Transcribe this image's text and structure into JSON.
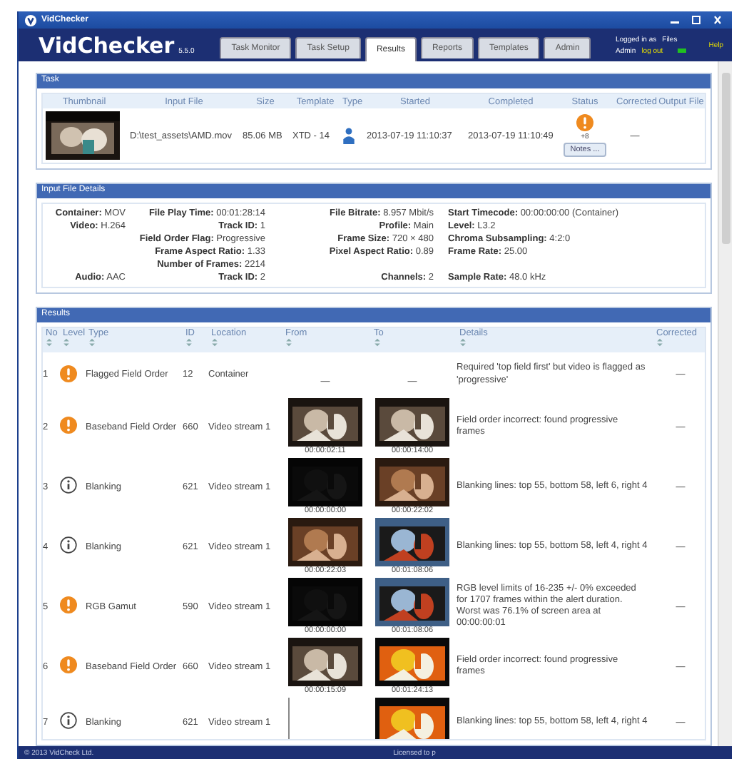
{
  "window": {
    "title": "VidChecker"
  },
  "header": {
    "logo": "VidChecker",
    "version": "5.5.0",
    "logged_in_label": "Logged in as",
    "user": "Admin",
    "logout": "log out",
    "files_label": "Files",
    "help": "Help"
  },
  "tabs": [
    {
      "label": "Task Monitor",
      "selected": false
    },
    {
      "label": "Task Setup",
      "selected": false
    },
    {
      "label": "Results",
      "selected": true
    },
    {
      "label": "Reports",
      "selected": false
    },
    {
      "label": "Templates",
      "selected": false
    },
    {
      "label": "Admin",
      "selected": false
    }
  ],
  "task": {
    "title": "Task",
    "columns": [
      "Thumbnail",
      "Input File",
      "Size",
      "Template",
      "Type",
      "Started",
      "Completed",
      "Status",
      "Corrected",
      "Output File"
    ],
    "row": {
      "input_file": "D:\\test_assets\\AMD.mov",
      "size": "85.06 MB",
      "template": "XTD - 14",
      "started": "2013-07-19 11:10:37",
      "completed": "2013-07-19 11:10:49",
      "status": {
        "kind": "warning",
        "count": "+8"
      },
      "notes": "Notes ...",
      "corrected": "—"
    }
  },
  "details": {
    "title": "Input File Details",
    "sections": [
      {
        "label": "Container:",
        "value": "MOV",
        "lines": [
          [
            {
              "label": "File Play Time:",
              "value": "00:01:28:14"
            },
            {
              "label": "File Bitrate:",
              "value": "8.957 Mbit/s"
            },
            {
              "label": "Start Timecode:",
              "value": "00:00:00:00 (Container)"
            }
          ]
        ]
      },
      {
        "label": "Video:",
        "value": "H.264",
        "lines": [
          [
            {
              "label": "Track ID:",
              "value": "1"
            },
            {
              "label": "Profile:",
              "value": "Main"
            },
            {
              "label": "Level:",
              "value": "L3.2"
            }
          ],
          [
            {
              "label": "Field Order Flag:",
              "value": "Progressive"
            },
            {
              "label": "Frame Size:",
              "value": "720 × 480"
            },
            {
              "label": "Chroma Subsampling:",
              "value": "4:2:0"
            }
          ],
          [
            {
              "label": "Frame Aspect Ratio:",
              "value": "1.33"
            },
            {
              "label": "Pixel Aspect Ratio:",
              "value": "0.89"
            },
            {
              "label": "Frame Rate:",
              "value": "25.00"
            }
          ],
          [
            {
              "label": "Number of Frames:",
              "value": "2214"
            }
          ]
        ]
      },
      {
        "label": "Audio:",
        "value": "AAC",
        "lines": [
          [
            {
              "label": "Track ID:",
              "value": "2"
            },
            {
              "label": "Channels:",
              "value": "2"
            },
            {
              "label": "Sample Rate:",
              "value": "48.0 kHz"
            }
          ]
        ]
      }
    ]
  },
  "results": {
    "title": "Results",
    "columns": [
      "No",
      "Level",
      "Type",
      "ID",
      "Location",
      "From",
      "To",
      "Details",
      "Corrected"
    ],
    "rows": [
      {
        "no": "1",
        "kind": "warning",
        "type": "Flagged Field Order",
        "id": "12",
        "location": "Container",
        "from": {
          "kind": "dash",
          "text": "—"
        },
        "to": {
          "kind": "dash",
          "text": "—"
        },
        "details": "Required 'top field first' but video is flagged as 'progressive'",
        "corrected": "—"
      },
      {
        "no": "2",
        "kind": "warning",
        "type": "Baseband Field Order",
        "id": "660",
        "location": "Video stream 1",
        "from": {
          "kind": "picture",
          "time": "00:00:02:11"
        },
        "to": {
          "kind": "picture",
          "time": "00:00:14:00"
        },
        "details": "Field order incorrect: found progressive frames",
        "corrected": "—"
      },
      {
        "no": "3",
        "kind": "info",
        "type": "Blanking",
        "id": "621",
        "location": "Video stream 1",
        "from": {
          "kind": "picture",
          "time": "00:00:00:00"
        },
        "to": {
          "kind": "picture",
          "time": "00:00:22:02"
        },
        "details": "Blanking lines: top 55, bottom 58, left 6, right 4",
        "corrected": "—"
      },
      {
        "no": "4",
        "kind": "info",
        "type": "Blanking",
        "id": "621",
        "location": "Video stream 1",
        "from": {
          "kind": "picture",
          "time": "00:00:22:03"
        },
        "to": {
          "kind": "picture",
          "time": "00:01:08:06"
        },
        "details": "Blanking lines: top 55, bottom 58, left 4, right 4",
        "corrected": "—"
      },
      {
        "no": "5",
        "kind": "warning",
        "type": "RGB Gamut",
        "id": "590",
        "location": "Video stream 1",
        "from": {
          "kind": "picture",
          "time": "00:00:00:00"
        },
        "to": {
          "kind": "picture",
          "time": "00:01:08:06"
        },
        "details": "RGB level limits of 16-235 +/- 0% exceeded for 1707 frames within the alert duration. Worst was 76.1% of screen area at 00:00:00:01",
        "corrected": "—"
      },
      {
        "no": "6",
        "kind": "warning",
        "type": "Baseband Field Order",
        "id": "660",
        "location": "Video stream 1",
        "from": {
          "kind": "picture",
          "time": "00:00:15:09"
        },
        "to": {
          "kind": "picture",
          "time": "00:01:24:13"
        },
        "details": "Field order incorrect: found progressive frames",
        "corrected": "—"
      },
      {
        "no": "7",
        "kind": "info",
        "type": "Blanking",
        "id": "621",
        "location": "Video stream 1",
        "from": {
          "kind": "blank"
        },
        "details": "Blanking lines: top 55, bottom 58, left 4, right 4",
        "corrected": "—"
      }
    ]
  },
  "footer": {
    "copyright": "© 2013 VidCheck Ltd.",
    "license": "Licensed to p"
  }
}
